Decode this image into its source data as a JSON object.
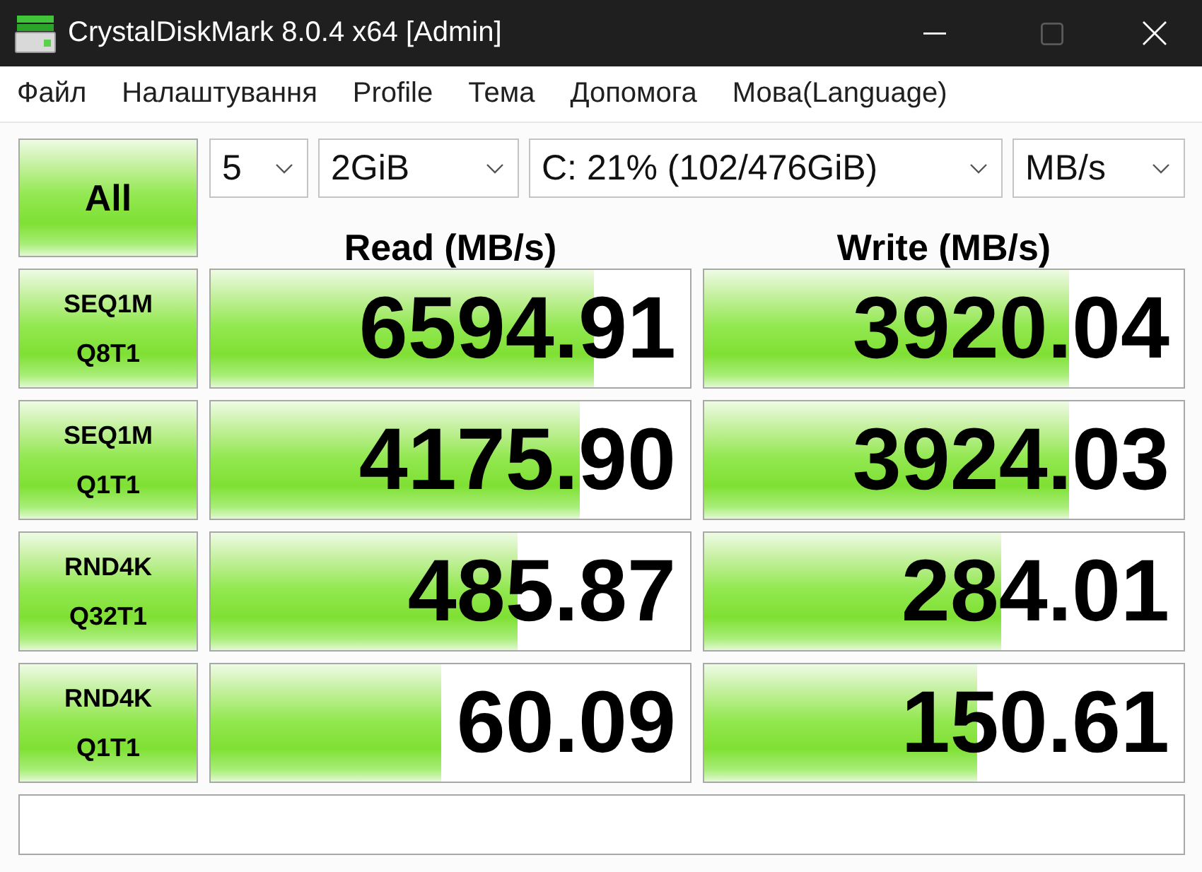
{
  "window": {
    "title": "CrystalDiskMark 8.0.4 x64 [Admin]",
    "controls": [
      {
        "kind": "minimize",
        "disabled": false
      },
      {
        "kind": "maximize",
        "disabled": true
      },
      {
        "kind": "close",
        "disabled": false
      }
    ]
  },
  "menu": [
    "Файл",
    "Налаштування",
    "Profile",
    "Тема",
    "Допомога",
    "Мова(Language)"
  ],
  "all_button": "All",
  "selectors": [
    {
      "value": "5"
    },
    {
      "value": "2GiB"
    },
    {
      "value": "C: 21% (102/476GiB)"
    },
    {
      "value": "MB/s"
    }
  ],
  "columns": [
    "Read (MB/s)",
    "Write (MB/s)"
  ],
  "tests": [
    {
      "name": "SEQ1M",
      "params": "Q8T1",
      "read": {
        "value": "6594.91",
        "level": 0.8
      },
      "write": {
        "value": "3920.04",
        "level": 0.76
      }
    },
    {
      "name": "SEQ1M",
      "params": "Q1T1",
      "read": {
        "value": "4175.90",
        "level": 0.77
      },
      "write": {
        "value": "3924.03",
        "level": 0.76
      }
    },
    {
      "name": "RND4K",
      "params": "Q32T1",
      "read": {
        "value": "485.87",
        "level": 0.64
      },
      "write": {
        "value": "284.01",
        "level": 0.62
      }
    },
    {
      "name": "RND4K",
      "params": "Q1T1",
      "read": {
        "value": "60.09",
        "level": 0.48
      },
      "write": {
        "value": "150.61",
        "level": 0.57
      }
    }
  ]
}
